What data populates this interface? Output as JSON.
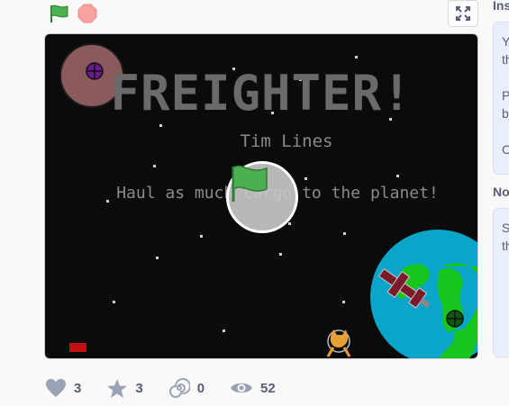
{
  "controls": {
    "flag_icon": "green-flag-icon",
    "stop_icon": "stop-sign-icon",
    "fullscreen_icon": "fullscreen-icon",
    "flag_color": "#4caf50",
    "stop_color": "#f7a1a1"
  },
  "stage": {
    "title": "FREIGHTER!",
    "author": "Tim Lines",
    "tagline": "Haul as much cargo to the planet!",
    "background_color": "#0b0b0b",
    "play_icon": "green-flag-icon"
  },
  "stats": {
    "loves": "3",
    "favorites": "3",
    "remixes": "0",
    "views": "52"
  },
  "sidebar": {
    "instructions_title": "Ins",
    "instructions_lines": [
      "Y",
      "th",
      "",
      "P",
      "b",
      "",
      "C"
    ],
    "notes_title": "No",
    "notes_lines": [
      "S",
      "th"
    ]
  }
}
